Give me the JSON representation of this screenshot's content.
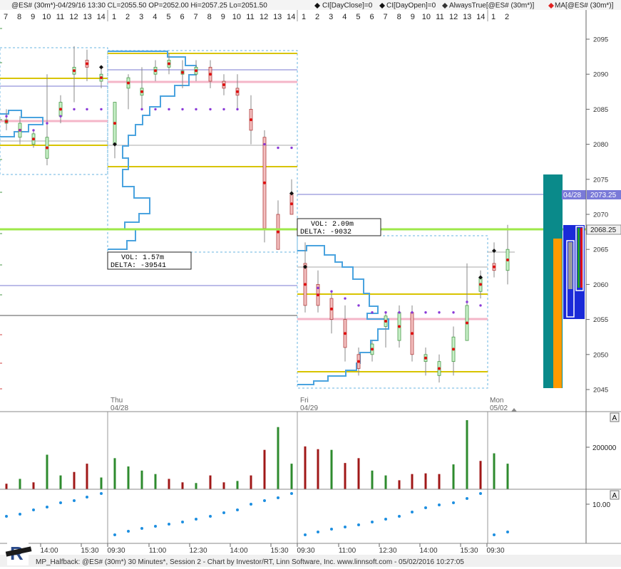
{
  "header": {
    "text": "@ES# (30m*)-04/29/16 13:30 CL=2055.50 OP=2052.00 Hi=2057.25 Lo=2051.50",
    "legend": [
      "CI[DayClose]=0",
      "CI[DayOpen]=0",
      "AlwaysTrue[@ES# (30m*)]",
      "MA[@ES# (30m*)]"
    ]
  },
  "session_bars": [
    {
      "labels": [
        "7",
        "8",
        "9",
        "10",
        "11",
        "12",
        "13",
        "14"
      ]
    },
    {
      "labels": [
        "1",
        "2",
        "3",
        "4",
        "5",
        "6",
        "7",
        "8",
        "9",
        "10",
        "11",
        "12",
        "13",
        "14"
      ]
    },
    {
      "labels": [
        "1",
        "2",
        "3",
        "4",
        "5",
        "6",
        "7",
        "8",
        "9",
        "10",
        "11",
        "12",
        "13",
        "14"
      ]
    },
    {
      "labels": [
        "1",
        "2"
      ]
    }
  ],
  "price_axis": {
    "ticks": [
      "2095",
      "2090",
      "2085",
      "2080",
      "2075",
      "2070",
      "2065",
      "2060",
      "2055",
      "2050",
      "2045"
    ],
    "marker_date": "04/28",
    "marker_price": "2073.25",
    "current_price": "2068.25"
  },
  "day_labels": [
    {
      "dow": "Thu",
      "date": "04/28"
    },
    {
      "dow": "Fri",
      "date": "04/29"
    },
    {
      "dow": "Mon",
      "date": "05/02"
    }
  ],
  "profiles": [
    {
      "vol": "VOL: 1.57m",
      "delta": "DELTA: -39541"
    },
    {
      "vol": "VOL: 2.09m",
      "delta": "DELTA: -9032"
    }
  ],
  "volume_panel": {
    "tick": "200000",
    "autoscale": "A"
  },
  "ma_panel": {
    "tick": "10.00",
    "autoscale": "A"
  },
  "time_axis": [
    "14:00",
    "15:30",
    "09:30",
    "11:00",
    "12:30",
    "14:00",
    "15:30",
    "09:30",
    "11:00",
    "12:30",
    "14:00",
    "15:30",
    "09:30"
  ],
  "status_bar": "MP_Halfback: @ES# (30m*) 30 Minutes*, Session 2 - Chart by Investor/RT, Linn Software, Inc. www.linnsoft.com - 05/02/2016 10:27:05",
  "colors": {
    "up": "#2e8b2e",
    "down": "#a01818",
    "profile": "#4aa3df",
    "value_line": "#d8c400",
    "poc_line": "#f4b6c8",
    "price_line": "#9ee84a"
  }
}
